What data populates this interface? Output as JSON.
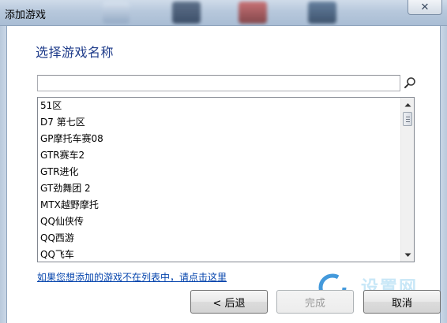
{
  "window": {
    "title": "添加游戏",
    "close_glyph": "✕"
  },
  "dialog": {
    "heading": "选择游戏名称",
    "search": {
      "value": "",
      "placeholder": ""
    },
    "game_list": [
      "51区",
      "D7 第七区",
      "GP摩托车赛08",
      "GTR赛车2",
      "GTR进化",
      "GT劲舞团 2",
      "MTX越野摩托",
      "QQ仙侠传",
      "QQ西游",
      "QQ飞车"
    ],
    "help_link": "如果您想添加的游戏不在列表中，请点击这里",
    "buttons": {
      "back": "< 后退",
      "finish": "完成",
      "cancel": "取消"
    }
  },
  "watermark": {
    "text": "设置网"
  },
  "colors": {
    "heading": "#1e3b8a",
    "link": "#0645ad",
    "disabled_text": "#9a9a9a",
    "watermark": "#bfe3f6"
  }
}
